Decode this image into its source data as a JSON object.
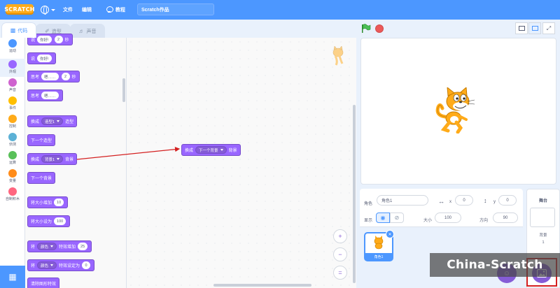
{
  "menubar": {
    "logo_text": "SCRATCH",
    "file_label": "文件",
    "edit_label": "编辑",
    "tutorial_label": "教程",
    "project_title": "Scratch作品"
  },
  "tabs": [
    {
      "label": "代码",
      "icon": "code-icon"
    },
    {
      "label": "造型",
      "icon": "brush-icon"
    },
    {
      "label": "声音",
      "icon": "speaker-icon"
    }
  ],
  "categories": [
    {
      "label": "运动",
      "color": "#4c97ff"
    },
    {
      "label": "外观",
      "color": "#9966ff"
    },
    {
      "label": "声音",
      "color": "#cf63cf"
    },
    {
      "label": "事件",
      "color": "#ffbf00"
    },
    {
      "label": "控制",
      "color": "#ffab19"
    },
    {
      "label": "侦测",
      "color": "#5cb1d6"
    },
    {
      "label": "运算",
      "color": "#59c059"
    },
    {
      "label": "变量",
      "color": "#ff8c1a"
    },
    {
      "label": "自制积木",
      "color": "#ff6680"
    }
  ],
  "palette": {
    "say_secs": {
      "label": "说",
      "text": "你好!",
      "secs": "2",
      "unit": "秒"
    },
    "say": {
      "label": "说",
      "text": "你好!"
    },
    "think_secs": {
      "label": "思考",
      "text": "嗯……",
      "secs": "2",
      "unit": "秒"
    },
    "think": {
      "label": "思考",
      "text": "嗯……"
    },
    "switch_costume": {
      "label": "换成",
      "value": "造型1",
      "suffix": "造型"
    },
    "next_costume": {
      "label": "下一个造型"
    },
    "switch_backdrop": {
      "label": "换成",
      "value": "背景1",
      "suffix": "背景"
    },
    "next_backdrop": {
      "label": "下一个背景"
    },
    "change_size": {
      "label": "将大小增加",
      "value": "10"
    },
    "set_size": {
      "label": "将大小设为",
      "value": "100"
    },
    "change_effect": {
      "label": "将",
      "effect": "颜色",
      "mid": "特效增加",
      "value": "25"
    },
    "set_effect": {
      "label": "将",
      "effect": "颜色",
      "mid": "特效设定为",
      "value": "0"
    },
    "clear_effects": {
      "label": "清除图形特效"
    }
  },
  "script": {
    "block": {
      "label": "换成",
      "value": "下一个背景",
      "suffix": "背景"
    }
  },
  "zoom": {
    "in": "+",
    "out": "−",
    "reset": "="
  },
  "sprite_info": {
    "sprite_label": "角色",
    "sprite_name": "角色1",
    "x_label": "x",
    "x_value": "0",
    "y_label": "y",
    "y_value": "0",
    "show_label": "显示",
    "size_label": "大小",
    "size_value": "100",
    "direction_label": "方向",
    "direction_value": "90"
  },
  "sprites": [
    {
      "name": "角色1",
      "selected": true
    }
  ],
  "stage_pane": {
    "title": "舞台",
    "backdrops_label": "背景",
    "backdrops_count": "1"
  },
  "watermark": "China-Scratch"
}
